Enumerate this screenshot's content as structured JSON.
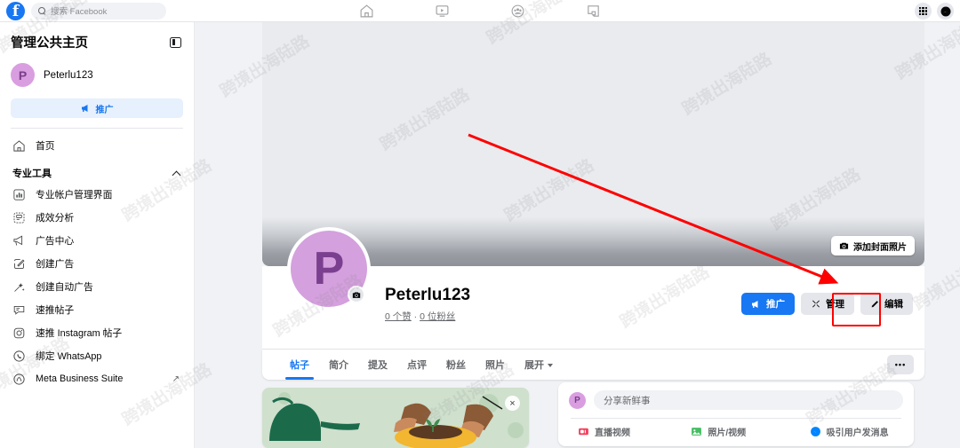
{
  "topbar": {
    "logo_letter": "f",
    "search_placeholder": "搜索 Facebook",
    "nav": [
      {
        "name": "home",
        "label": "首页"
      },
      {
        "name": "watch",
        "label": "视频"
      },
      {
        "name": "groups",
        "label": "小组"
      },
      {
        "name": "gaming",
        "label": "游戏"
      }
    ],
    "menu_label": "菜单",
    "messenger_label": "Messenger"
  },
  "sidebar": {
    "title": "管理公共主页",
    "collapse_label": "收起",
    "page": {
      "avatar_letter": "P",
      "name": "Peterlu123"
    },
    "promote_button": "推广",
    "home_item": "首页",
    "section_title": "专业工具",
    "items": [
      {
        "label": "专业帐户管理界面",
        "icon": "bar-chart-icon"
      },
      {
        "label": "成效分析",
        "icon": "insights-icon"
      },
      {
        "label": "广告中心",
        "icon": "megaphone-icon"
      },
      {
        "label": "创建广告",
        "icon": "pencil-square-icon"
      },
      {
        "label": "创建自动广告",
        "icon": "magic-wand-icon"
      },
      {
        "label": "速推帖子",
        "icon": "speech-bubble-icon"
      },
      {
        "label": "速推 Instagram 帖子",
        "icon": "instagram-icon"
      },
      {
        "label": "绑定 WhatsApp",
        "icon": "whatsapp-icon"
      },
      {
        "label": "Meta Business Suite",
        "icon": "meta-icon",
        "external": "↗"
      }
    ]
  },
  "cover": {
    "add_cover_button": "添加封面照片"
  },
  "profile": {
    "avatar_letter": "P",
    "name": "Peterlu123",
    "stats": "0 个赞 · 0 位粉丝",
    "likes_text": "0 个赞",
    "sep": " · ",
    "followers_text": "0 位粉丝",
    "buttons": [
      {
        "label": "推广",
        "style": "blue",
        "icon": "megaphone-icon"
      },
      {
        "label": "管理",
        "style": "grey",
        "icon": "tools-icon",
        "highlighted": true
      },
      {
        "label": "编辑",
        "style": "grey",
        "icon": "pencil-icon"
      }
    ]
  },
  "tabs": {
    "items": [
      {
        "label": "帖子",
        "active": true
      },
      {
        "label": "简介",
        "active": false
      },
      {
        "label": "提及",
        "active": false
      },
      {
        "label": "点评",
        "active": false
      },
      {
        "label": "粉丝",
        "active": false
      },
      {
        "label": "照片",
        "active": false
      },
      {
        "label": "展开",
        "active": false,
        "caret": true
      }
    ],
    "more_button": "•••"
  },
  "promo_card": {
    "close_label": "×",
    "alt": "园艺插图"
  },
  "composer": {
    "avatar_letter": "P",
    "placeholder": "分享新鲜事",
    "actions": [
      {
        "label": "直播视频",
        "icon": "live-video-icon",
        "color": "#f3425f"
      },
      {
        "label": "照片/视频",
        "icon": "photo-video-icon",
        "color": "#45bd62"
      },
      {
        "label": "吸引用户发消息",
        "icon": "messenger-icon",
        "color": "#0084ff"
      }
    ]
  },
  "annotation": {
    "arrow_color": "#fe0000",
    "box_color": "#fe0000",
    "target": "管理"
  },
  "watermark": {
    "text": "跨境出海陆路"
  },
  "colors": {
    "brand_blue": "#1877f2",
    "page_bg": "#f0f2f5",
    "card_bg": "#ffffff",
    "avatar_purple": "#d4a0dd",
    "annotation_red": "#fe0000"
  }
}
